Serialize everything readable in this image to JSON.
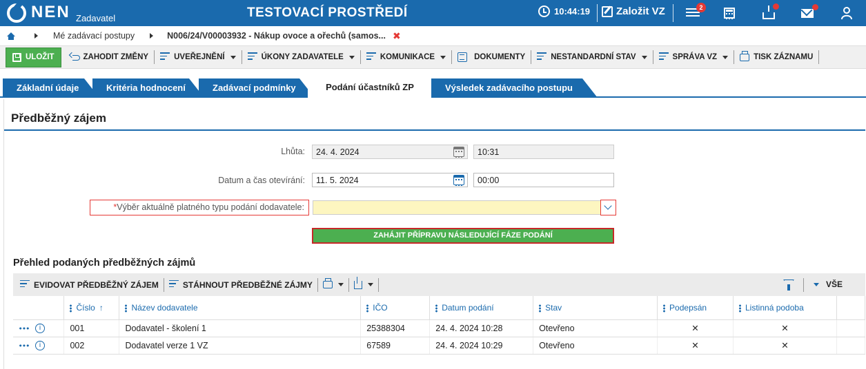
{
  "header": {
    "logo_text": "NEN",
    "logo_sub": "Zadavatel",
    "env_title": "TESTOVACÍ PROSTŘEDÍ",
    "clock": "10:44:19",
    "create_vz": "Založit VZ",
    "menu_badge": "2",
    "icons": [
      "clock-icon",
      "edit-icon",
      "menu-icon",
      "calculator-icon",
      "inbox-icon",
      "mail-icon",
      "user-icon"
    ]
  },
  "breadcrumb": {
    "item1": "Mé zadávací postupy",
    "item2": "N006/24/V00003932 - Nákup ovoce a ořechů (samos...",
    "close": "✖"
  },
  "toolbar": {
    "save": "ULOŽIT",
    "discard": "ZAHODIT ZMĚNY",
    "publish": "UVEŘEJNĚNÍ",
    "actions": "ÚKONY ZADAVATELE",
    "communication": "KOMUNIKACE",
    "documents": "DOKUMENTY",
    "nonstandard": "NESTANDARDNÍ STAV",
    "admin": "SPRÁVA VZ",
    "print": "TISK ZÁZNAMU"
  },
  "tabs": [
    "Základní údaje",
    "Kritéria hodnocení",
    "Zadávací podmínky",
    "Podání účastníků ZP",
    "Výsledek zadávacího postupu"
  ],
  "active_tab": "Podání účastníků ZP",
  "section": {
    "title": "Předběžný zájem",
    "deadline_label": "Lhůta:",
    "deadline_date": "24. 4. 2024",
    "deadline_time": "10:31",
    "opening_label": "Datum a čas otevírání:",
    "opening_date": "11. 5. 2024",
    "opening_time": "00:00",
    "submission_type_star": "*",
    "submission_type_label": "Výběr aktuálně platného typu podání dodavatele:",
    "submission_type_value": "",
    "start_button": "ZAHÁJIT PŘÍPRAVU NÁSLEDUJÍCÍ FÁZE PODÁNÍ"
  },
  "grid": {
    "title": "Přehled podaných předběžných zájmů",
    "toolbar": {
      "register": "EVIDOVAT PŘEDBĚŽNÝ ZÁJEM",
      "download": "STÁHNOUT PŘEDBĚŽNÉ ZÁJMY",
      "all": "VŠE"
    },
    "columns": {
      "number": "Číslo",
      "sort": "↑",
      "supplier": "Název dodavatele",
      "ico": "IČO",
      "date": "Datum podání",
      "status": "Stav",
      "signed": "Podepsán",
      "paper": "Listinná podoba"
    },
    "rows": [
      {
        "number": "001",
        "supplier": "Dodavatel - školení 1",
        "ico": "25388304",
        "date": "24. 4. 2024 10:28",
        "status": "Otevřeno",
        "signed": "✕",
        "paper": "✕"
      },
      {
        "number": "002",
        "supplier": "Dodavatel verze 1 VZ",
        "ico": "67589",
        "date": "24. 4. 2024 10:29",
        "status": "Otevřeno",
        "signed": "✕",
        "paper": "✕"
      }
    ],
    "info_glyph": "i"
  },
  "colors": {
    "brand_blue": "#1a6aad",
    "save_green": "#4caf50",
    "error_red": "#e53935",
    "required_yellow": "#fdf6c0"
  }
}
